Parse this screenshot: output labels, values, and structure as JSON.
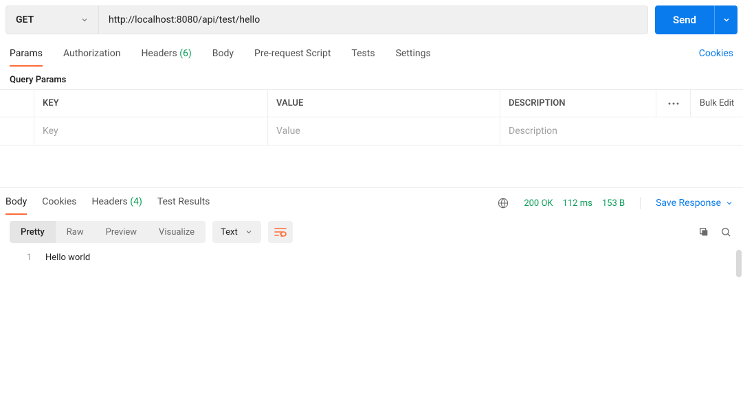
{
  "request": {
    "method": "GET",
    "url": "http://localhost:8080/api/test/hello",
    "send_label": "Send"
  },
  "req_tabs": {
    "params": "Params",
    "authorization": "Authorization",
    "headers_label": "Headers",
    "headers_count": "(6)",
    "body": "Body",
    "prerequest": "Pre-request Script",
    "tests": "Tests",
    "settings": "Settings",
    "cookies": "Cookies"
  },
  "qp": {
    "title": "Query Params",
    "key_header": "KEY",
    "value_header": "VALUE",
    "desc_header": "DESCRIPTION",
    "bulk_edit": "Bulk Edit",
    "key_ph": "Key",
    "value_ph": "Value",
    "desc_ph": "Description"
  },
  "resp_tabs": {
    "body": "Body",
    "cookies": "Cookies",
    "headers_label": "Headers",
    "headers_count": "(4)",
    "test_results": "Test Results"
  },
  "status": {
    "code": "200 OK",
    "time": "112 ms",
    "size": "153 B"
  },
  "save_response": "Save Response",
  "view_modes": {
    "pretty": "Pretty",
    "raw": "Raw",
    "preview": "Preview",
    "visualize": "Visualize"
  },
  "lang": "Text",
  "response_body": {
    "line_no": "1",
    "content": "Hello world"
  }
}
